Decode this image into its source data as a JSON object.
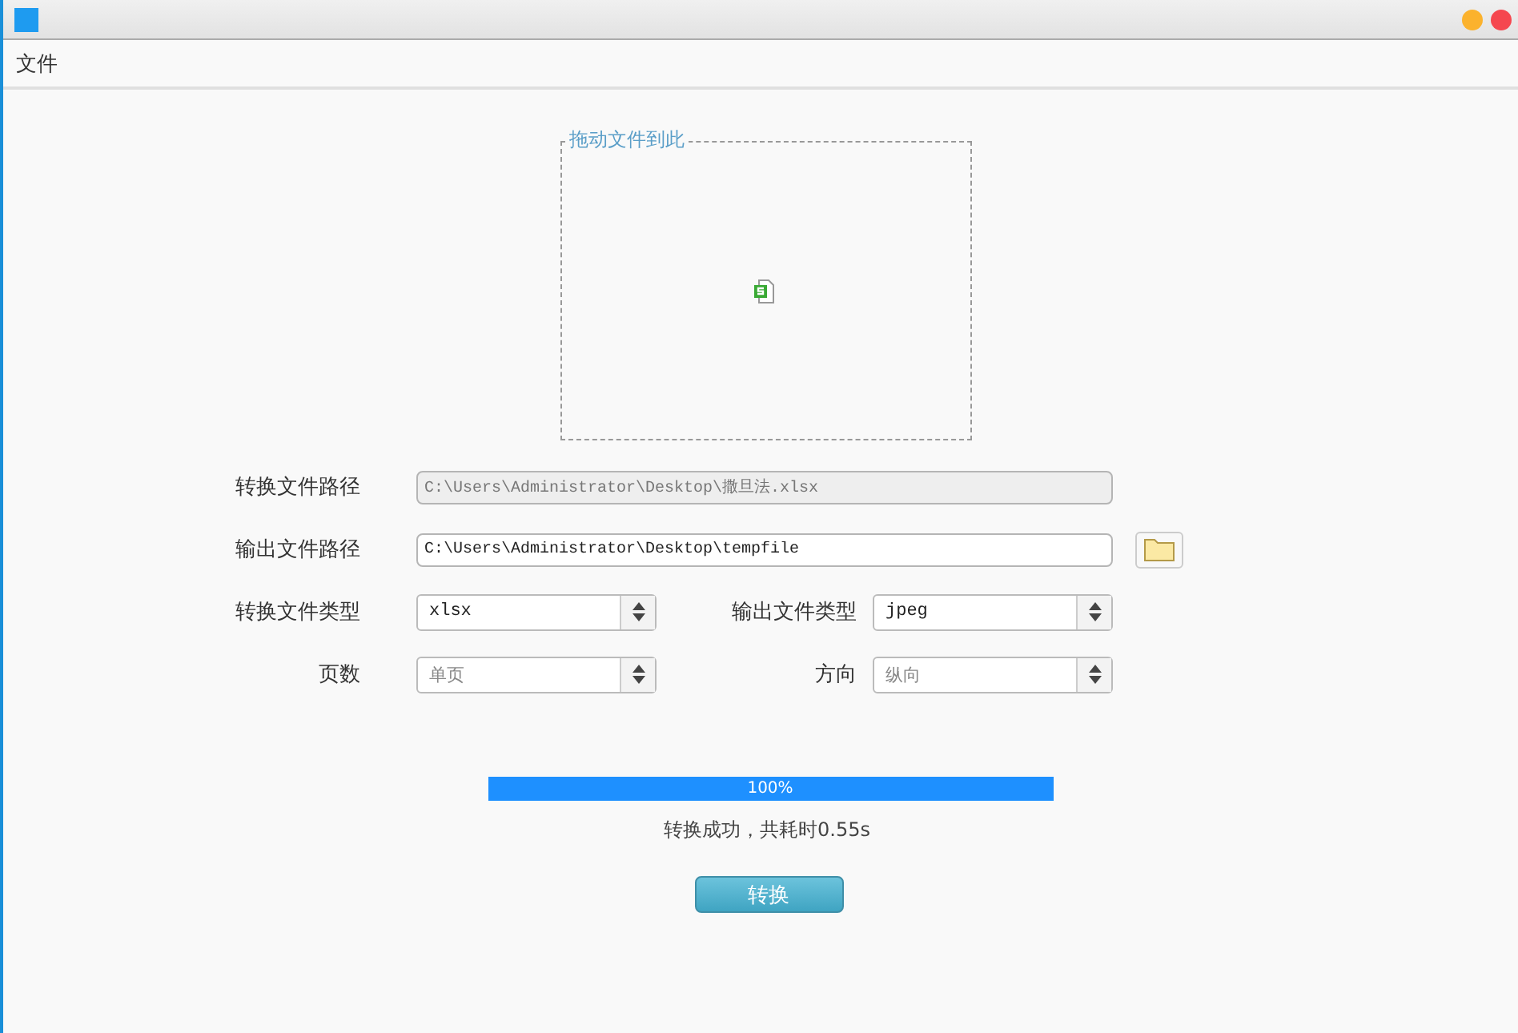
{
  "menu": [
    "文件"
  ],
  "drop_zone": {
    "legend": "拖动文件到此"
  },
  "paths": [
    {
      "label": "转换文件路径",
      "value": "C:\\Users\\Administrator\\Desktop\\撒旦法.xlsx",
      "disabled": true,
      "browse": false
    },
    {
      "label": "输出文件路径",
      "value": "C:\\Users\\Administrator\\Desktop\\tempfile",
      "disabled": false,
      "browse": true
    }
  ],
  "selects": [
    [
      {
        "label": "转换文件类型",
        "value": "xlsx",
        "disabled": false
      },
      {
        "label": "输出文件类型",
        "value": "jpeg",
        "disabled": false
      }
    ],
    [
      {
        "label": "页数",
        "value": "单页",
        "disabled": true
      },
      {
        "label": "方向",
        "value": "纵向",
        "disabled": true
      }
    ]
  ],
  "progress": {
    "level": 1,
    "label": "100%"
  },
  "status": "转换成功，共耗时0.55s",
  "convert_button": "转换"
}
